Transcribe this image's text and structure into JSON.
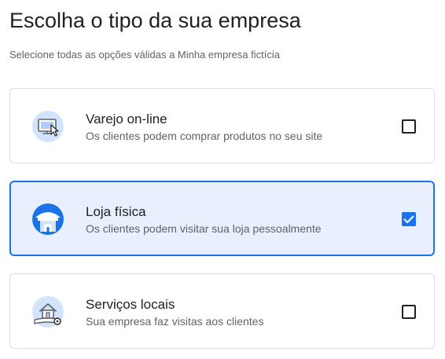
{
  "page": {
    "title": "Escolha o tipo da sua empresa",
    "subtitle": "Selecione todas as opções válidas a Minha empresa fictícia"
  },
  "options": [
    {
      "title": "Varejo on-line",
      "description": "Os clientes podem comprar produtos no seu site",
      "icon": "online-store-icon",
      "checked": false
    },
    {
      "title": "Loja física",
      "description": "Os clientes podem visitar sua loja pessoalmente",
      "icon": "storefront-icon",
      "checked": true
    },
    {
      "title": "Serviços locais",
      "description": "Sua empresa faz visitas aos clientes",
      "icon": "local-services-icon",
      "checked": false
    }
  ],
  "colors": {
    "accent": "#1a73e8",
    "selected_background": "#e8f0fe",
    "icon_background": "#d2e3fc",
    "text_primary": "#202124",
    "text_secondary": "#5f6368",
    "border": "#dadce0"
  }
}
